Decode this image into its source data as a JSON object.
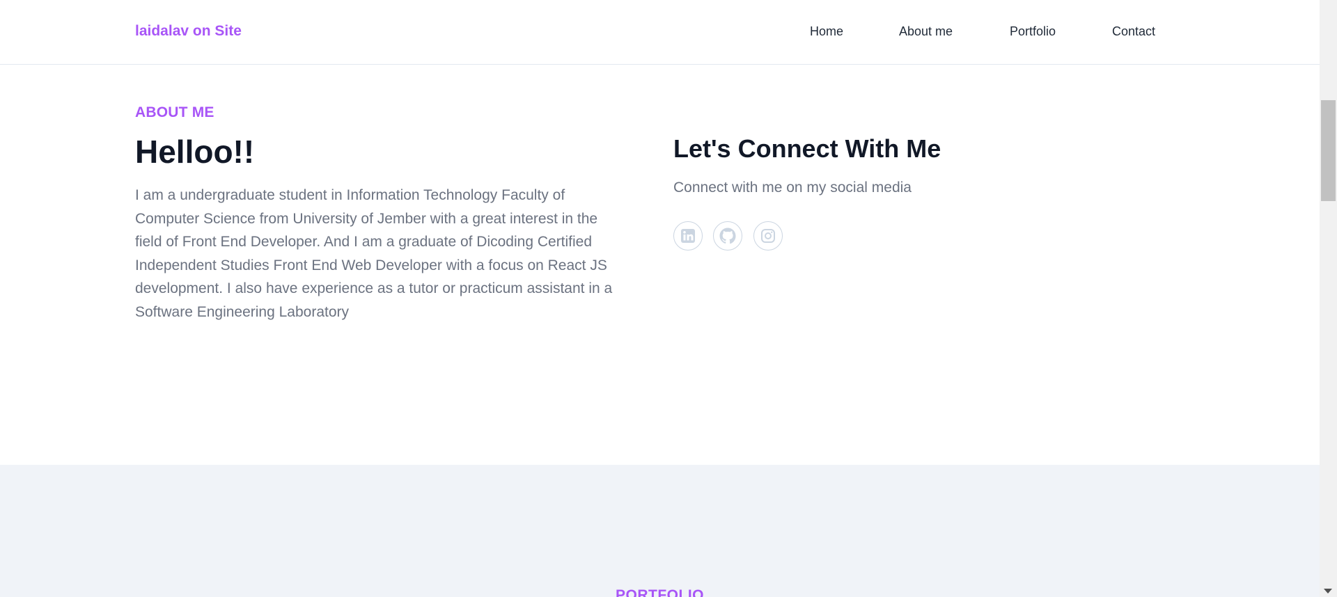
{
  "navbar": {
    "brand": "laidalav on Site",
    "links": [
      "Home",
      "About me",
      "Portfolio",
      "Contact"
    ]
  },
  "about": {
    "label": "ABOUT ME",
    "heading": "Helloo!!",
    "bio": "I am a undergraduate student in Information Technology Faculty of Computer Science from University of Jember with a great interest in the field of Front End Developer. And I am a graduate of Dicoding Certified Independent Studies Front End Web Developer with a focus on React JS development. I also have experience as a tutor or practicum assistant in a Software Engineering Laboratory",
    "connect_heading": "Let's Connect With Me",
    "connect_sub": "Connect with me on my social media",
    "social_icons": [
      "linkedin-icon",
      "github-icon",
      "instagram-icon"
    ]
  },
  "portfolio": {
    "label": "PORTFOLIO"
  },
  "colors": {
    "accent": "#a855f7",
    "heading": "#111827",
    "body_text": "#6b7280",
    "icon": "#cbd5e1",
    "portfolio_bg": "#f0f3f8"
  }
}
